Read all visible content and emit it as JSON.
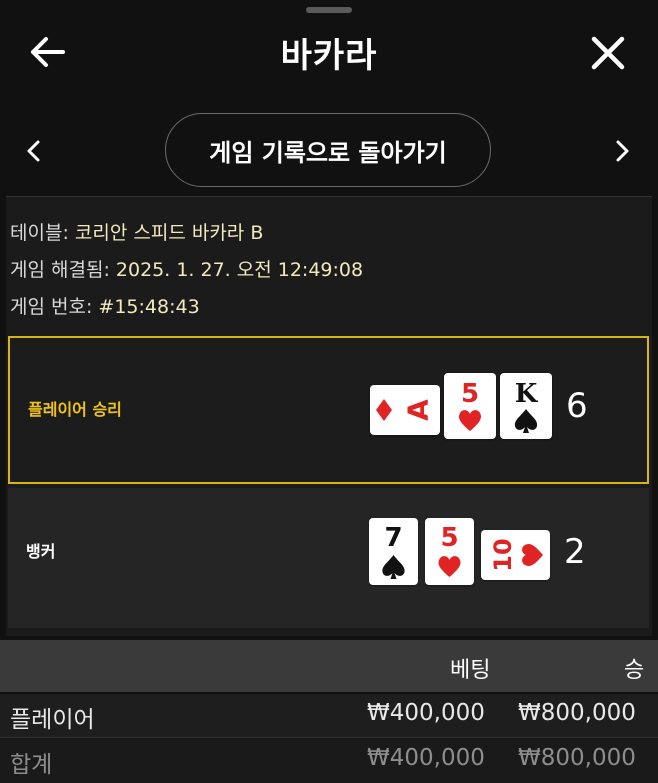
{
  "header": {
    "title": "바카라",
    "back_icon": "arrow-left-icon",
    "close_icon": "close-icon"
  },
  "nav": {
    "back_to_history_label": "게임 기록으로 돌아가기",
    "prev_icon": "chevron-left-icon",
    "next_icon": "chevron-right-icon"
  },
  "info": {
    "table_label": "테이블:",
    "table_value": "코리안 스피드 바카라 B",
    "resolved_label": "게임 해결됨:",
    "resolved_value": "2025. 1. 27. 오전 12:49:08",
    "number_label": "게임 번호:",
    "number_value": "#15:48:43"
  },
  "hands": {
    "player": {
      "label": "플레이어 승리",
      "score": "6",
      "cards": [
        {
          "rank": "A",
          "suit": "diamonds",
          "color": "#e02424",
          "rotated": true
        },
        {
          "rank": "5",
          "suit": "hearts",
          "color": "#e02424"
        },
        {
          "rank": "K",
          "suit": "spades",
          "color": "#111111"
        }
      ]
    },
    "banker": {
      "label": "뱅커",
      "score": "2",
      "cards": [
        {
          "rank": "7",
          "suit": "spades",
          "color": "#111111"
        },
        {
          "rank": "5",
          "suit": "hearts",
          "color": "#e02424"
        },
        {
          "rank": "10",
          "suit": "hearts",
          "color": "#e02424",
          "rotated": true
        }
      ]
    }
  },
  "table": {
    "col_bet": "베팅",
    "col_win": "승",
    "rows": [
      {
        "name": "플레이어",
        "bet": "₩400,000",
        "win": "₩800,000"
      }
    ],
    "total": {
      "name": "합계",
      "bet": "₩400,000",
      "win": "₩800,000"
    }
  },
  "colors": {
    "accent": "#f0c419",
    "highlight_border": "#d9b514",
    "red_suit": "#e02424"
  }
}
